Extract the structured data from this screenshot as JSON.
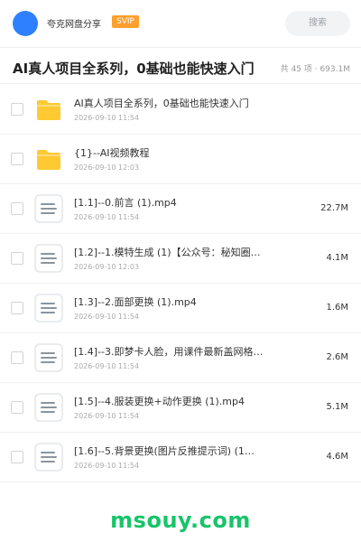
{
  "header": {
    "user_name": "夸克网盘分享",
    "badge": "SVIP",
    "search_placeholder": "搜索",
    "avatar_color": "#2f80ff"
  },
  "folder": {
    "title": "AI真人项目全系列，0基础也能快速入门",
    "meta": "共 45 项 · 693.1M"
  },
  "files": [
    {
      "type": "folder",
      "icon": "folder-icon",
      "name": "AI真人项目全系列，0基础也能快速入门",
      "date": "2026-09-10 11:54",
      "size": ""
    },
    {
      "type": "folder",
      "icon": "folder-icon",
      "name": "{1}--AI视频教程",
      "date": "2026-09-10 12:03",
      "size": ""
    },
    {
      "type": "file",
      "icon": "document-icon",
      "name": "[1.1]--0.前言 (1).mp4",
      "date": "2026-09-10 11:54",
      "size": "22.7M"
    },
    {
      "type": "file",
      "icon": "document-icon",
      "name": "[1.2]--1.模特生成 (1)【公众号：秘知圈…",
      "date": "2026-09-10 12:03",
      "size": "4.1M"
    },
    {
      "type": "file",
      "icon": "document-icon",
      "name": "[1.3]--2.面部更换 (1).mp4",
      "date": "2026-09-10 11:54",
      "size": "1.6M"
    },
    {
      "type": "file",
      "icon": "document-icon",
      "name": "[1.4]--3.即梦卡人脸，用课件最新盖网格方式…",
      "date": "2026-09-10 11:54",
      "size": "2.6M"
    },
    {
      "type": "file",
      "icon": "document-icon",
      "name": "[1.5]--4.服装更换+动作更换 (1).mp4",
      "date": "2026-09-10 11:54",
      "size": "5.1M"
    },
    {
      "type": "file",
      "icon": "document-icon",
      "name": "[1.6]--5.背景更换(图片反推提示词) (1…",
      "date": "2026-09-10 11:54",
      "size": "4.6M"
    }
  ],
  "watermark": "msouy.com",
  "colors": {
    "folder_yellow": "#ffc933",
    "badge_orange": "#ff9f2e",
    "watermark_green": "#19c46a"
  }
}
